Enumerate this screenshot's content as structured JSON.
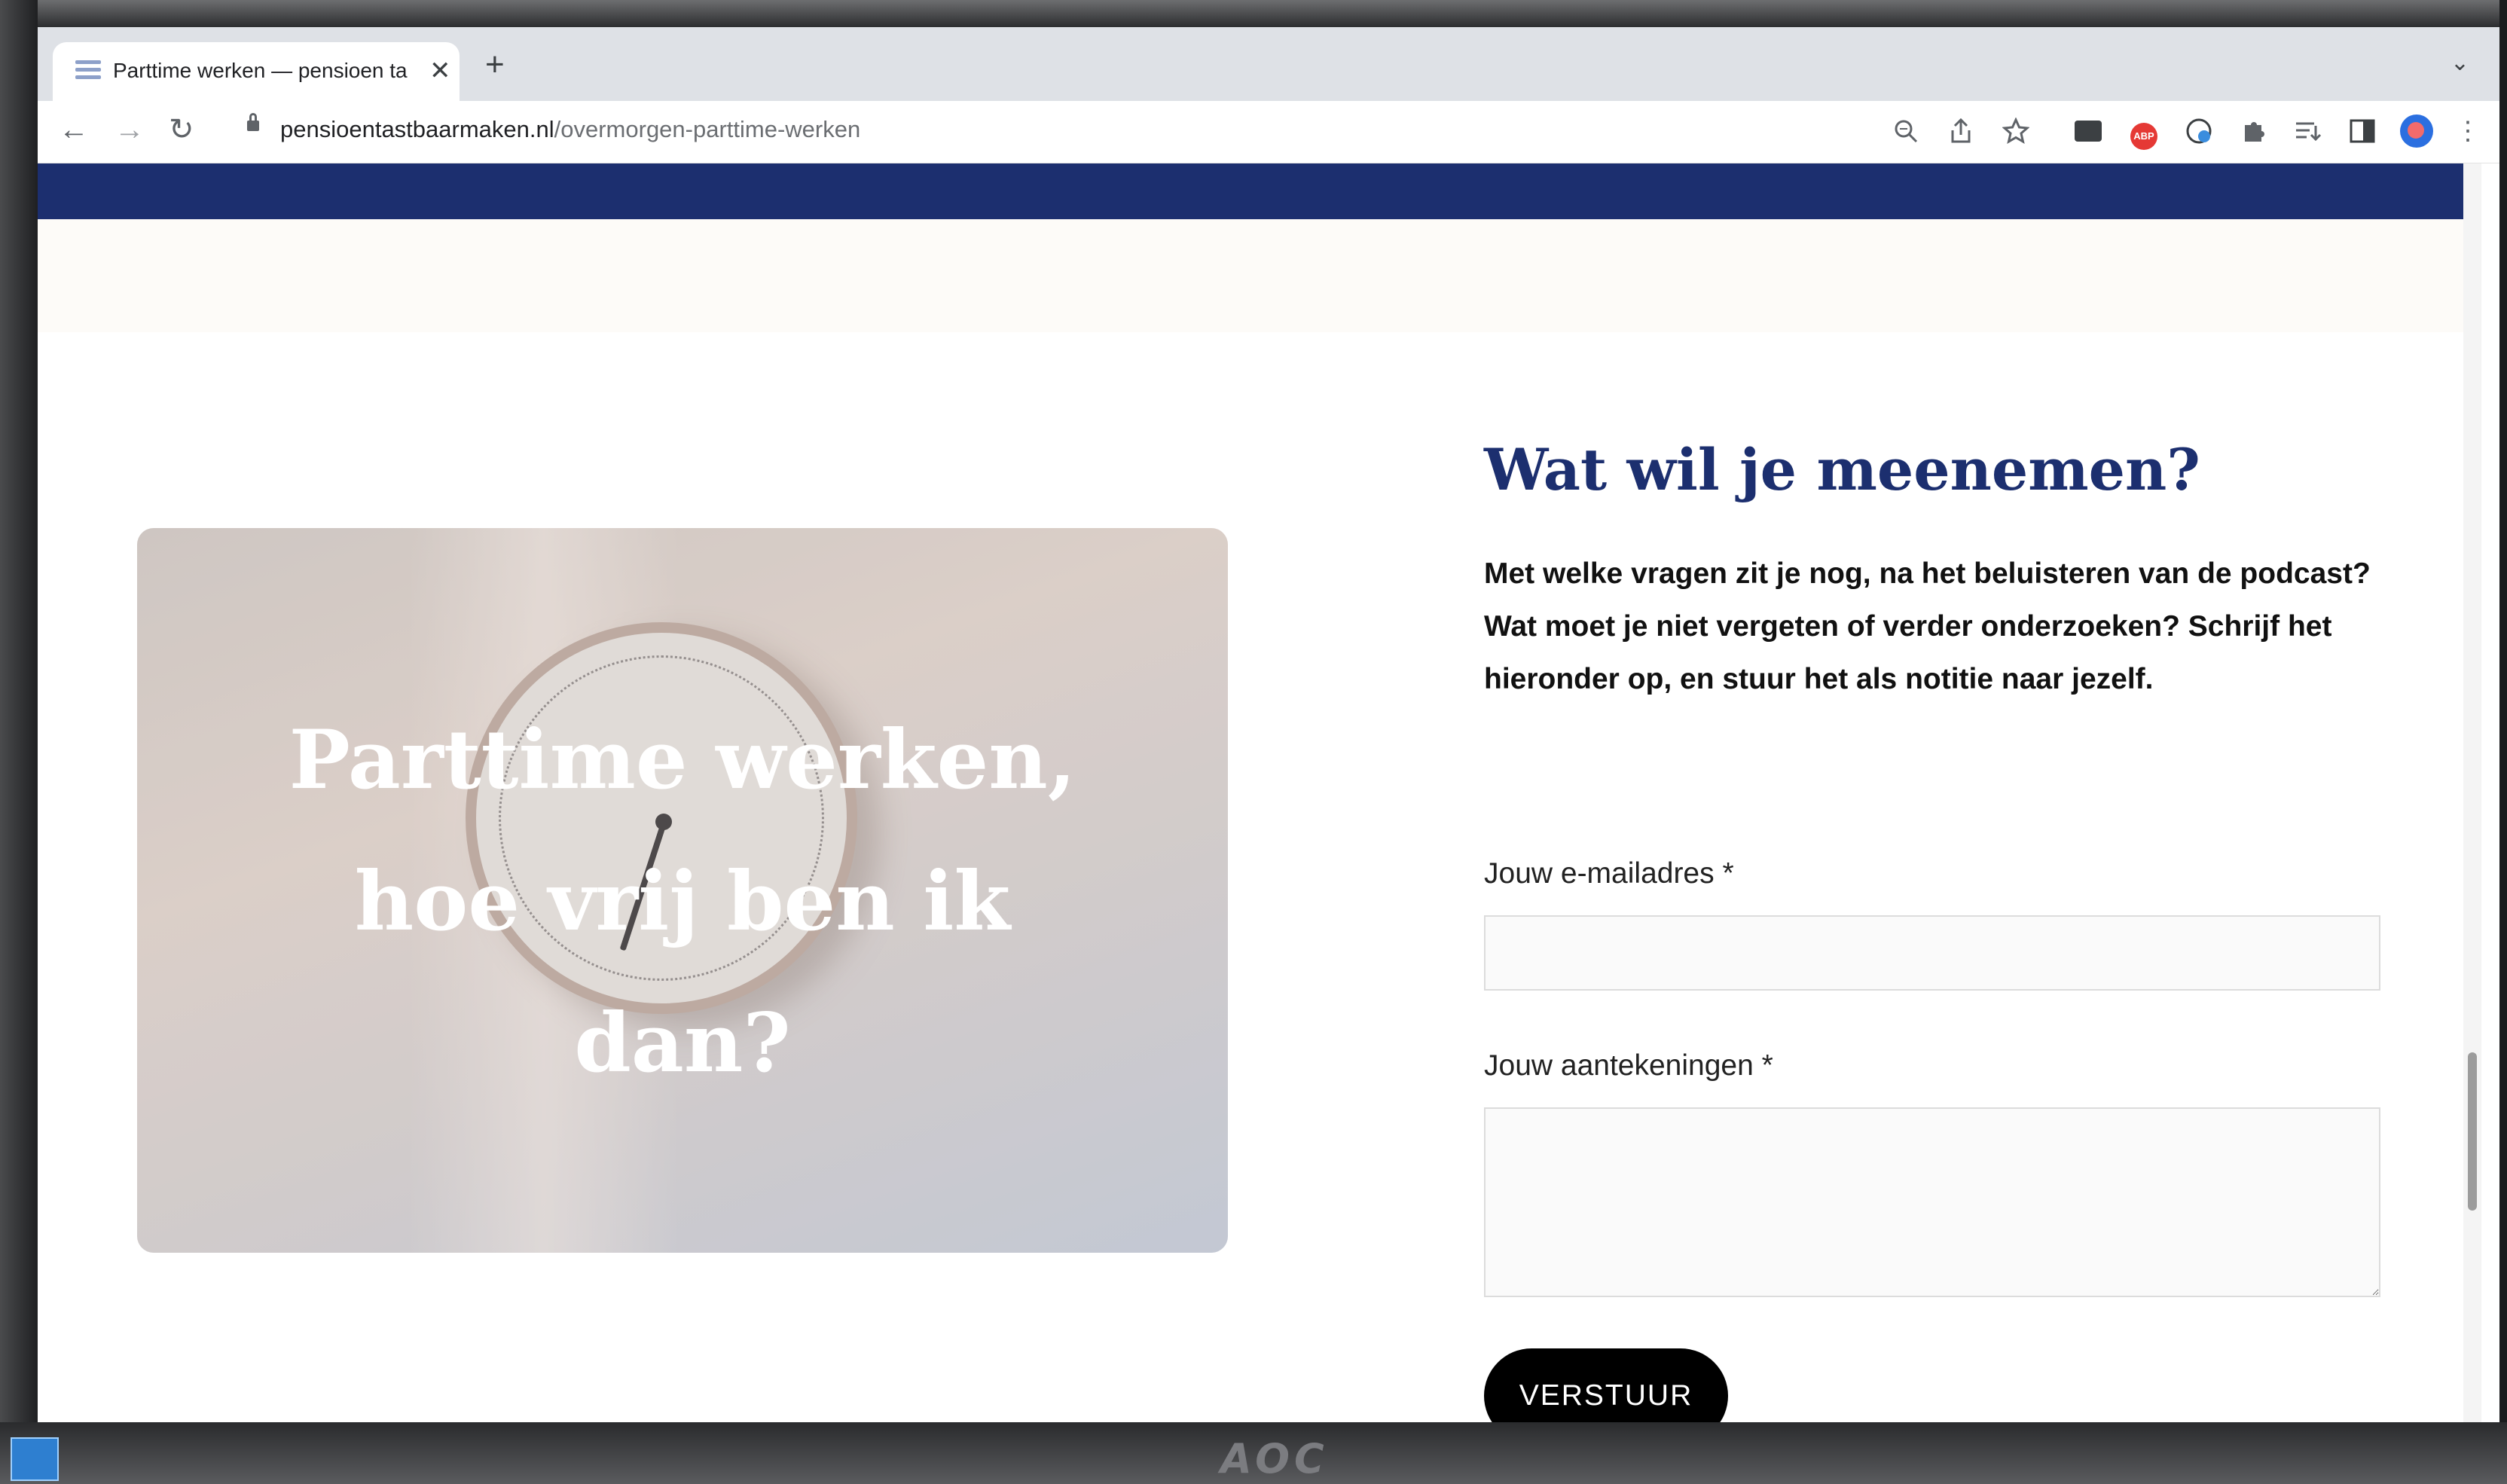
{
  "browser": {
    "tab": {
      "title": "Parttime werken — pensioen ta",
      "close": "✕"
    },
    "new_tab": "+",
    "tab_search": "⌄",
    "nav": {
      "back": "←",
      "forward": "→",
      "reload": "↻"
    },
    "url": {
      "host": "pensioentastbaarmaken.nl",
      "path": "/overmorgen-parttime-werken"
    },
    "toolbar_icons": {
      "zoom": "zoom-icon",
      "share": "share-icon",
      "bookmark": "star-icon",
      "extension_adblock_label": "ABP",
      "extensions": "puzzle-icon",
      "reading_list": "reading-list-icon",
      "side_panel": "side-panel-icon",
      "menu": "⋮"
    }
  },
  "colors": {
    "brand_navy": "#1c2f6f",
    "button": "#000000"
  },
  "hero": {
    "title_lines": [
      "Parttime werken,",
      "hoe vrij ben ik",
      "dan?"
    ]
  },
  "form": {
    "title": "Wat wil je meenemen?",
    "intro": "Met welke vragen zit je nog, na het beluisteren van de podcast? Wat moet je niet vergeten of verder onderzoeken? Schrijf het hieronder op, en stuur het als notitie naar jezelf.",
    "email_label": "Jouw e-mailadres *",
    "email_value": "",
    "notes_label": "Jouw aantekeningen *",
    "notes_value": "",
    "submit_label": "VERSTUUR"
  },
  "monitor": {
    "brand": "AOC"
  }
}
